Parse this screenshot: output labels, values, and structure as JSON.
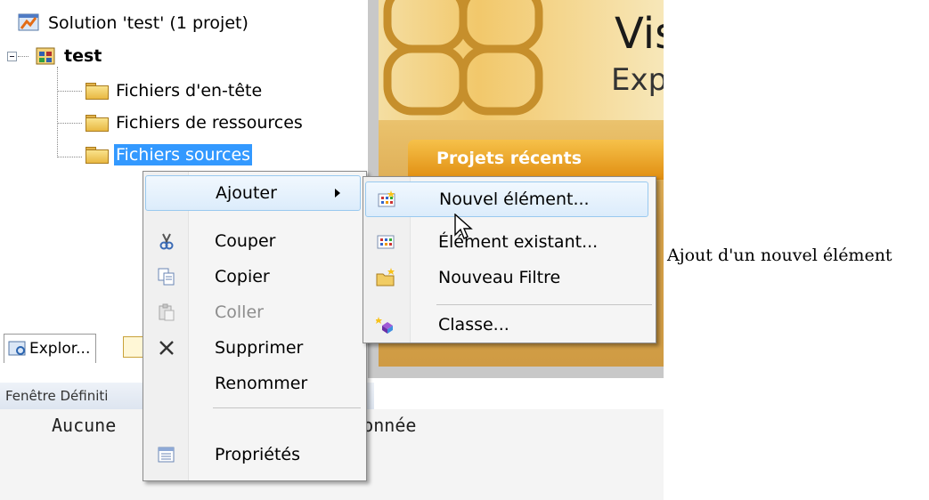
{
  "solution_explorer": {
    "solution_label": "Solution 'test' (1 projet)",
    "project_label": "test",
    "folders": [
      {
        "label": "Fichiers d'en-tête"
      },
      {
        "label": "Fichiers de ressources"
      },
      {
        "label": "Fichiers sources",
        "selected": true
      }
    ]
  },
  "start_page": {
    "logo_text": "Vis",
    "logo_sub": "Exp",
    "recent_projects_tab": "Projets récents"
  },
  "tool_tabs": {
    "explorer_tab": "Explor..."
  },
  "definition_window": {
    "title": "Fenêtre Définiti",
    "content": "Aucune                   ectionnée"
  },
  "context_menu": {
    "items": [
      {
        "label": "Ajouter",
        "has_submenu": true,
        "icon": ""
      },
      {
        "label": "Couper",
        "icon": "cut-icon"
      },
      {
        "label": "Copier",
        "icon": "copy-icon"
      },
      {
        "label": "Coller",
        "icon": "paste-icon",
        "disabled": true
      },
      {
        "label": "Supprimer",
        "icon": "delete-icon"
      },
      {
        "label": "Renommer",
        "icon": ""
      },
      {
        "label": "Propriétés",
        "icon": "properties-icon"
      }
    ]
  },
  "submenu": {
    "items": [
      {
        "label": "Nouvel élément...",
        "icon": "new-item-icon"
      },
      {
        "label": "Élément existant...",
        "icon": "existing-item-icon"
      },
      {
        "label": "Nouveau Filtre",
        "icon": "new-filter-icon"
      },
      {
        "label": "Classe...",
        "icon": "class-icon"
      }
    ]
  },
  "caption": "Ajout d'un nouvel élément",
  "colors": {
    "selection": "#3399ff",
    "menu_hover": "#dcecfb",
    "recent_tab": "#e08d10"
  }
}
